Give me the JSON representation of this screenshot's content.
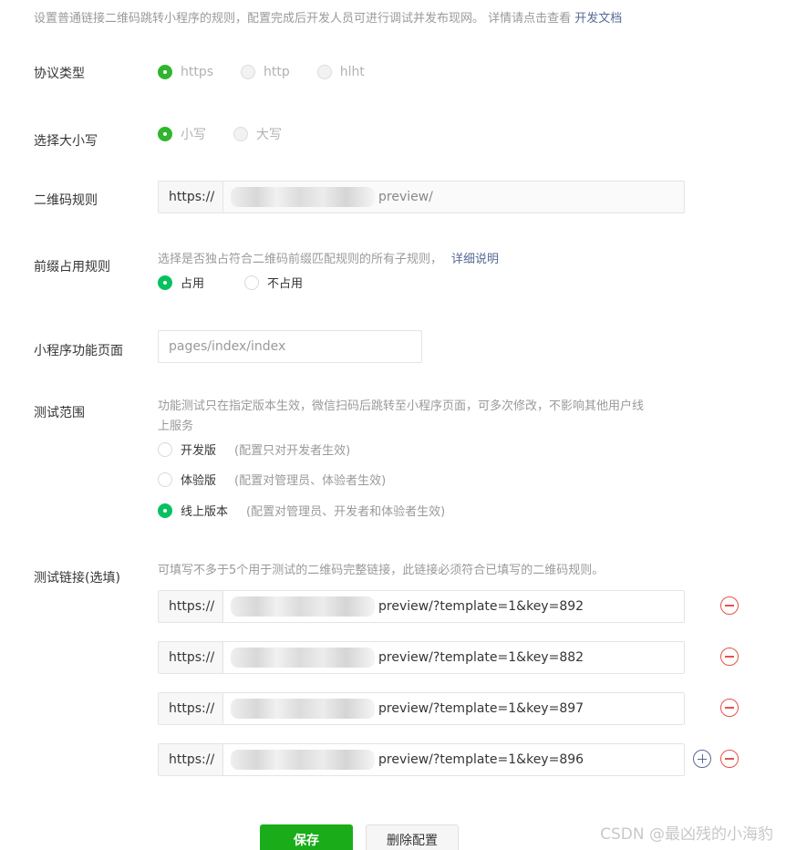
{
  "intro": {
    "text": "设置普通链接二维码跳转小程序的规则，配置完成后开发人员可进行调试并发布现网。 详情请点击查看",
    "link": "开发文档"
  },
  "protocol": {
    "label": "协议类型",
    "options": [
      {
        "label": "https",
        "selected": true
      },
      {
        "label": "http",
        "selected": false
      },
      {
        "label": "hlht",
        "selected": false
      }
    ]
  },
  "case": {
    "label": "选择大小写",
    "options": [
      {
        "label": "小写",
        "selected": true
      },
      {
        "label": "大写",
        "selected": false
      }
    ]
  },
  "qr_rule": {
    "label": "二维码规则",
    "prefix": "https://",
    "value_suffix": "preview/"
  },
  "prefix_rule": {
    "label": "前缀占用规则",
    "help": "选择是否独占符合二维码前缀匹配规则的所有子规则，",
    "help_link": "详细说明",
    "options": [
      {
        "label": "占用",
        "selected": true
      },
      {
        "label": "不占用",
        "selected": false
      }
    ]
  },
  "page": {
    "label": "小程序功能页面",
    "value": "pages/index/index"
  },
  "scope": {
    "label": "测试范围",
    "help_line1": "功能测试只在指定版本生效，微信扫码后跳转至小程序页面，可多次修改，不影响其他用户线",
    "help_line2": "上服务",
    "options": [
      {
        "label": "开发版",
        "note": "(配置只对开发者生效)",
        "selected": false
      },
      {
        "label": "体验版",
        "note": "(配置对管理员、体验者生效)",
        "selected": false
      },
      {
        "label": "线上版本",
        "note": "(配置对管理员、开发者和体验者生效)",
        "selected": true
      }
    ]
  },
  "test_links": {
    "label": "测试链接(选填)",
    "help": "可填写不多于5个用于测试的二维码完整链接，此链接必须符合已填写的二维码规则。",
    "prefix": "https://",
    "links": [
      {
        "suffix": "preview/?template=1&key=892"
      },
      {
        "suffix": "preview/?template=1&key=882"
      },
      {
        "suffix": "preview/?template=1&key=897"
      },
      {
        "suffix": "preview/?template=1&key=896"
      }
    ]
  },
  "actions": {
    "save": "保存",
    "delete": "删除配置"
  },
  "watermark": "CSDN @最凶残的小海豹",
  "colors": {
    "accent_green": "#1aad19",
    "radio_green": "#07c160",
    "link_blue": "#576b95",
    "remove_red": "#e5534b"
  }
}
